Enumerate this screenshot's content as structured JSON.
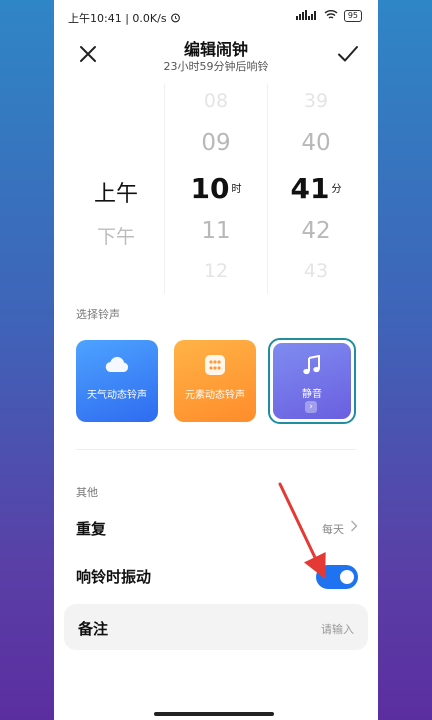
{
  "status_bar": {
    "time": "上午10:41",
    "speed": "0.0K/s",
    "signal": "4G",
    "battery": "95"
  },
  "header": {
    "title": "编辑闹钟",
    "subtitle": "23小时59分钟后响铃",
    "close_icon": "close-icon",
    "confirm_icon": "check-icon"
  },
  "picker": {
    "ampm": [
      "上午",
      "下午"
    ],
    "hours": [
      "08",
      "09",
      "10",
      "11",
      "12"
    ],
    "hour_unit": "时",
    "minutes": [
      "39",
      "40",
      "41",
      "42",
      "43"
    ],
    "minute_unit": "分"
  },
  "ringtone": {
    "section_label": "选择铃声",
    "options": [
      {
        "label": "天气动态铃声",
        "icon": "cloud-icon",
        "color": "#3d86f5"
      },
      {
        "label": "元素动态铃声",
        "icon": "grid-icon",
        "color": "#ff9a3a"
      },
      {
        "label": "静音",
        "icon": "music-note-icon",
        "color": "#7078ea",
        "selected": true
      }
    ]
  },
  "other": {
    "section_label": "其他",
    "repeat": {
      "label": "重复",
      "value": "每天"
    },
    "vibrate": {
      "label": "响铃时振动",
      "enabled": true
    },
    "note": {
      "label": "备注",
      "placeholder": "请输入"
    }
  },
  "accent_color": "#1f73f0",
  "annotation_color": "#e53935"
}
